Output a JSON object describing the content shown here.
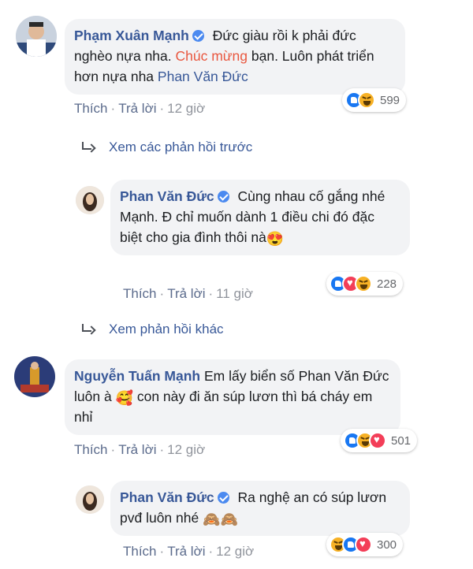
{
  "comments": [
    {
      "author": "Phạm Xuân Mạnh",
      "text_1": "Đức giàu rồi k phải đức nghèo nựa nha.",
      "text_highlight": "Chúc mừng",
      "text_2": "bạn. Luôn phát triển hơn nựa nha",
      "tag": "Phan Văn Đức",
      "like": "Thích",
      "reply": "Trả lời",
      "time": "12 giờ",
      "reaction_count": "599"
    },
    {
      "author": "Phan Văn Đức",
      "text_1": "Cùng nhau cố gắng nhé Mạnh. Đ chỉ muốn dành 1 điều chi đó đặc biệt cho gia đình thôi nà",
      "emoji": "😍",
      "like": "Thích",
      "reply": "Trả lời",
      "time": "11 giờ",
      "reaction_count": "228"
    },
    {
      "author": "Nguyễn Tuấn Mạnh",
      "text_1": "Em lấy biển số Phan Văn Đức luôn à",
      "emoji": "🥰",
      "text_2": "con này đi ăn súp lươn thì bá cháy em nhỉ",
      "like": "Thích",
      "reply": "Trả lời",
      "time": "12 giờ",
      "reaction_count": "501"
    },
    {
      "author": "Phan Văn Đức",
      "text_1": "Ra nghệ an có súp lươn pvđ luôn nhé",
      "emoji": "🙈🙈",
      "like": "Thích",
      "reply": "Trả lời",
      "time": "12 giờ",
      "reaction_count": "300"
    }
  ],
  "links": {
    "previous_replies": "Xem các phản hồi trước",
    "more_replies": "Xem phản hồi khác"
  },
  "colors": {
    "author": "#385898",
    "bubble": "#f2f3f5",
    "highlight": "#e9573f",
    "meta": "#90949c"
  },
  "icons": [
    "verified-badge-icon",
    "reply-arrow-icon",
    "like-reaction-icon",
    "haha-reaction-icon",
    "love-reaction-icon"
  ]
}
